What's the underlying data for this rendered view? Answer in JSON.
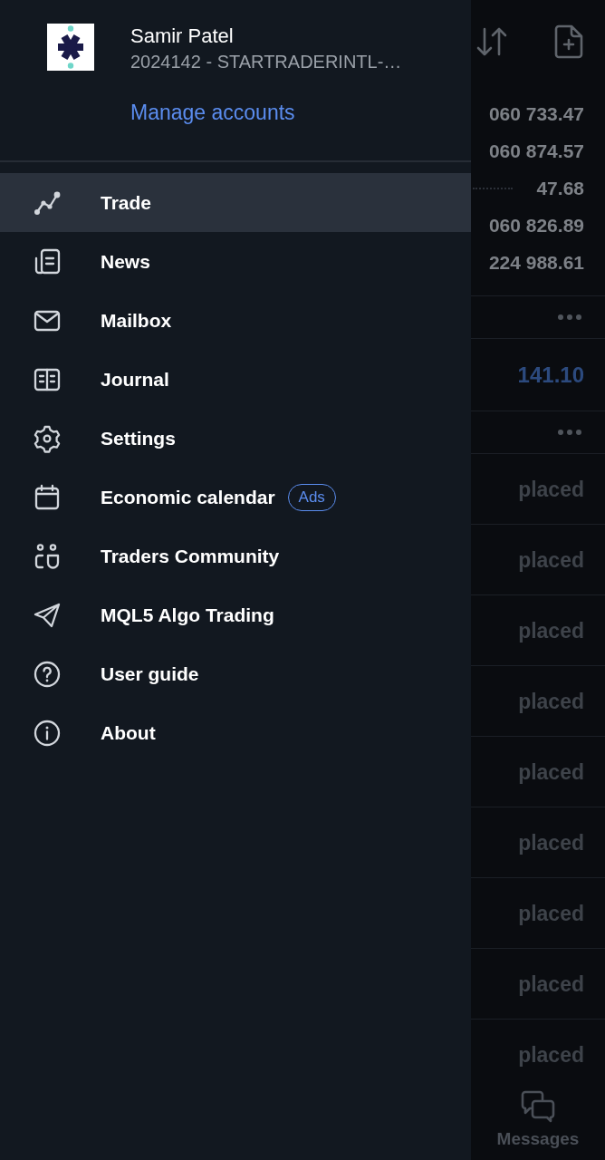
{
  "drawer": {
    "account": {
      "name": "Samir Patel",
      "login": "2024142 - STARTRADERINTL-…",
      "manage_link": "Manage accounts"
    },
    "menu": [
      {
        "label": "Trade",
        "selected": true
      },
      {
        "label": "News",
        "selected": false
      },
      {
        "label": "Mailbox",
        "selected": false
      },
      {
        "label": "Journal",
        "selected": false
      },
      {
        "label": "Settings",
        "selected": false
      },
      {
        "label": "Economic calendar",
        "selected": false,
        "badge": "Ads"
      },
      {
        "label": "Traders Community",
        "selected": false
      },
      {
        "label": "MQL5 Algo Trading",
        "selected": false
      },
      {
        "label": "User guide",
        "selected": false
      },
      {
        "label": "About",
        "selected": false
      }
    ]
  },
  "background_screen": {
    "balance_rows": [
      {
        "value": "060 733.47",
        "leader": false
      },
      {
        "value": "060 874.57",
        "leader": false
      },
      {
        "value": "47.68",
        "leader": true
      },
      {
        "value": "060 826.89",
        "leader": false
      },
      {
        "value": "224 988.61",
        "leader": false
      }
    ],
    "list_rows": [
      {
        "kind": "more"
      },
      {
        "kind": "value",
        "value": "141.10"
      },
      {
        "kind": "more"
      }
    ],
    "orders": [
      {
        "status": "placed"
      },
      {
        "status": "placed"
      },
      {
        "status": "placed"
      },
      {
        "status": "placed"
      },
      {
        "status": "placed"
      },
      {
        "status": "placed"
      },
      {
        "status": "placed"
      },
      {
        "status": "placed"
      },
      {
        "status": "placed"
      }
    ],
    "bottom_nav": {
      "label": "Messages"
    }
  }
}
